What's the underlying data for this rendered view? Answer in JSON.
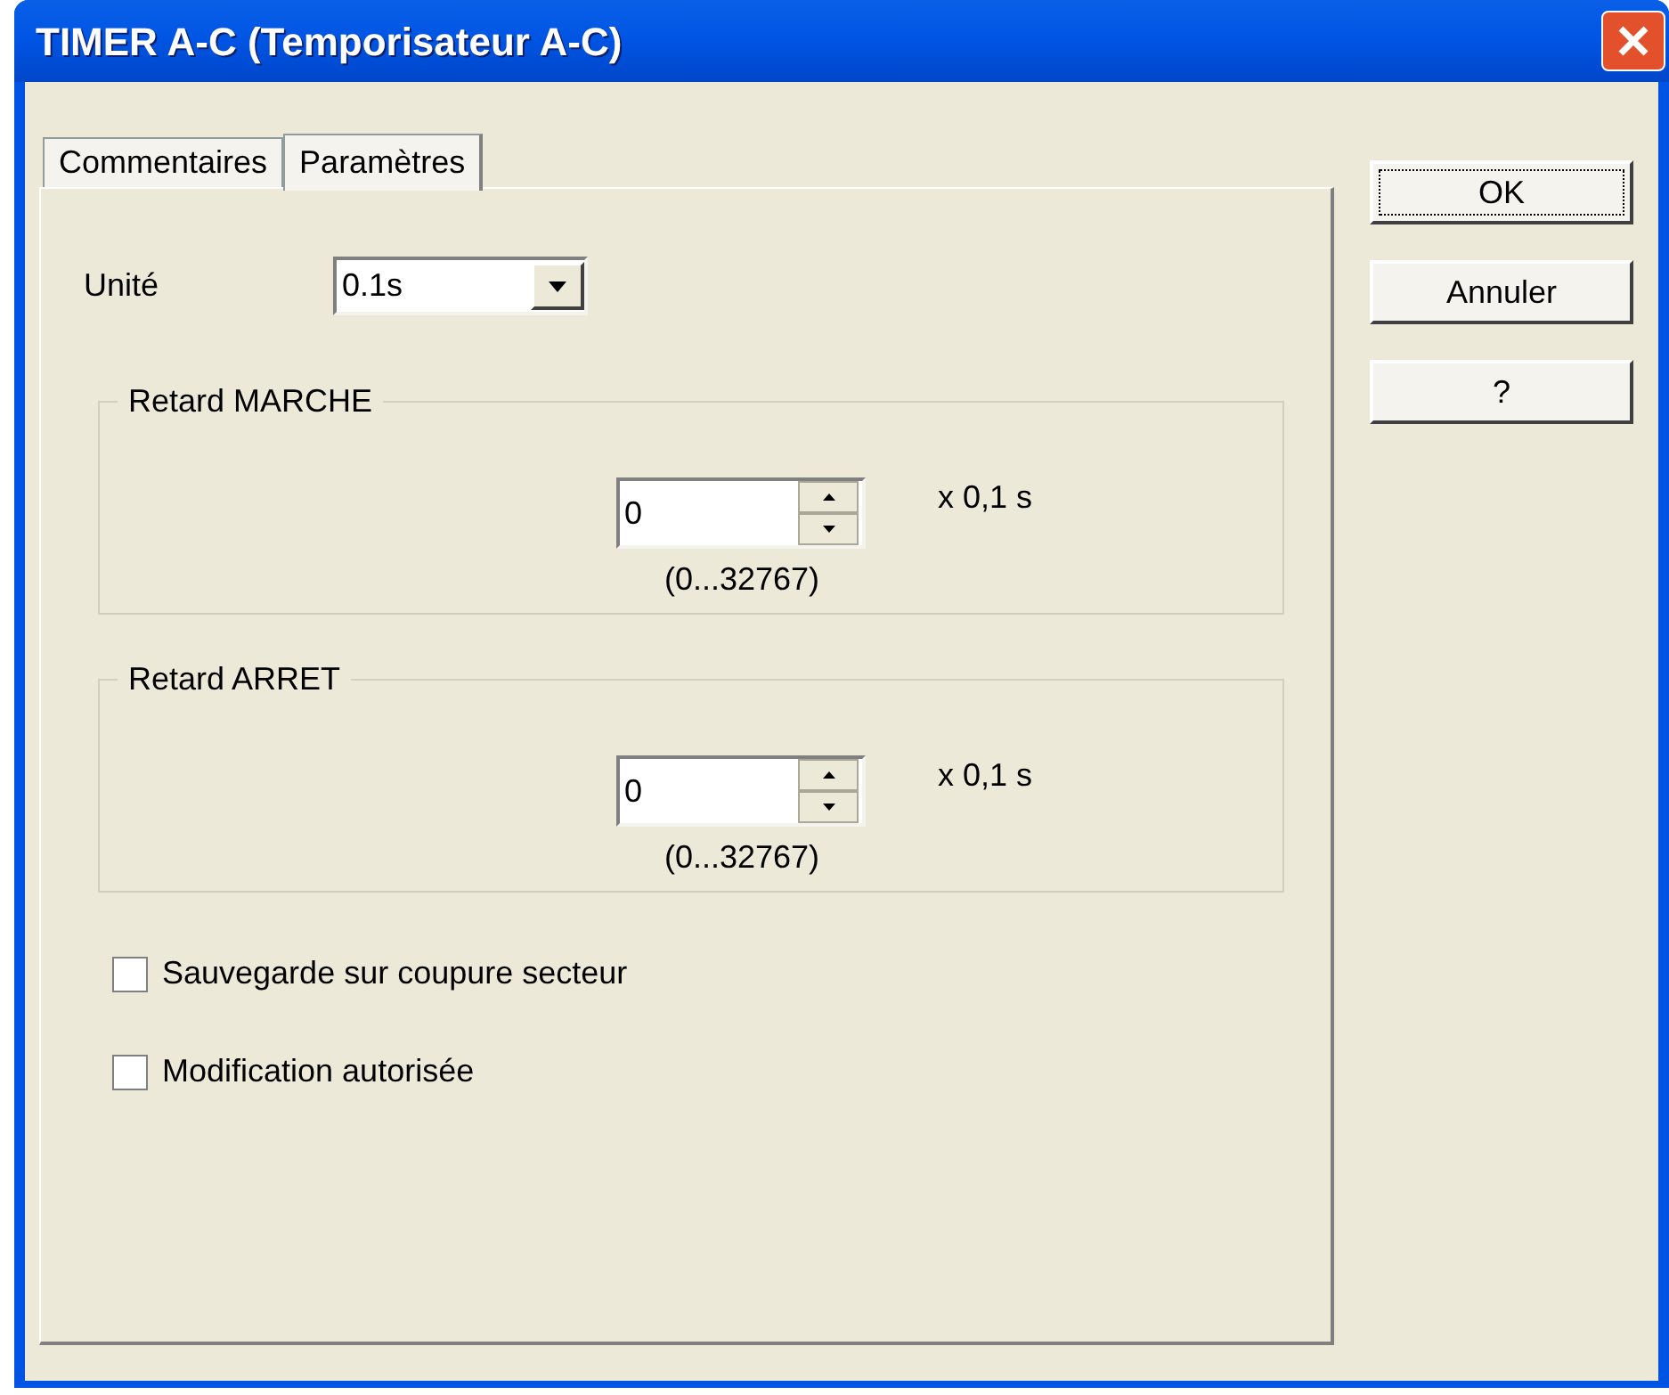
{
  "window": {
    "title": "TIMER A-C (Temporisateur A-C)"
  },
  "tabs": [
    {
      "label": "Commentaires",
      "selected": false
    },
    {
      "label": "Paramètres",
      "selected": true
    }
  ],
  "unit": {
    "label": "Unité",
    "value": "0.1s"
  },
  "groups": [
    {
      "title": "Retard MARCHE",
      "value": "0",
      "suffix": "x 0,1 s",
      "range": "(0...32767)"
    },
    {
      "title": "Retard ARRET",
      "value": "0",
      "suffix": "x 0,1 s",
      "range": "(0...32767)"
    }
  ],
  "checkboxes": [
    {
      "label": "Sauvegarde sur coupure secteur",
      "checked": false
    },
    {
      "label": "Modification autorisée",
      "checked": false
    }
  ],
  "buttons": [
    {
      "label": "OK",
      "focused": true
    },
    {
      "label": "Annuler",
      "focused": false
    },
    {
      "label": "?",
      "focused": false
    }
  ]
}
